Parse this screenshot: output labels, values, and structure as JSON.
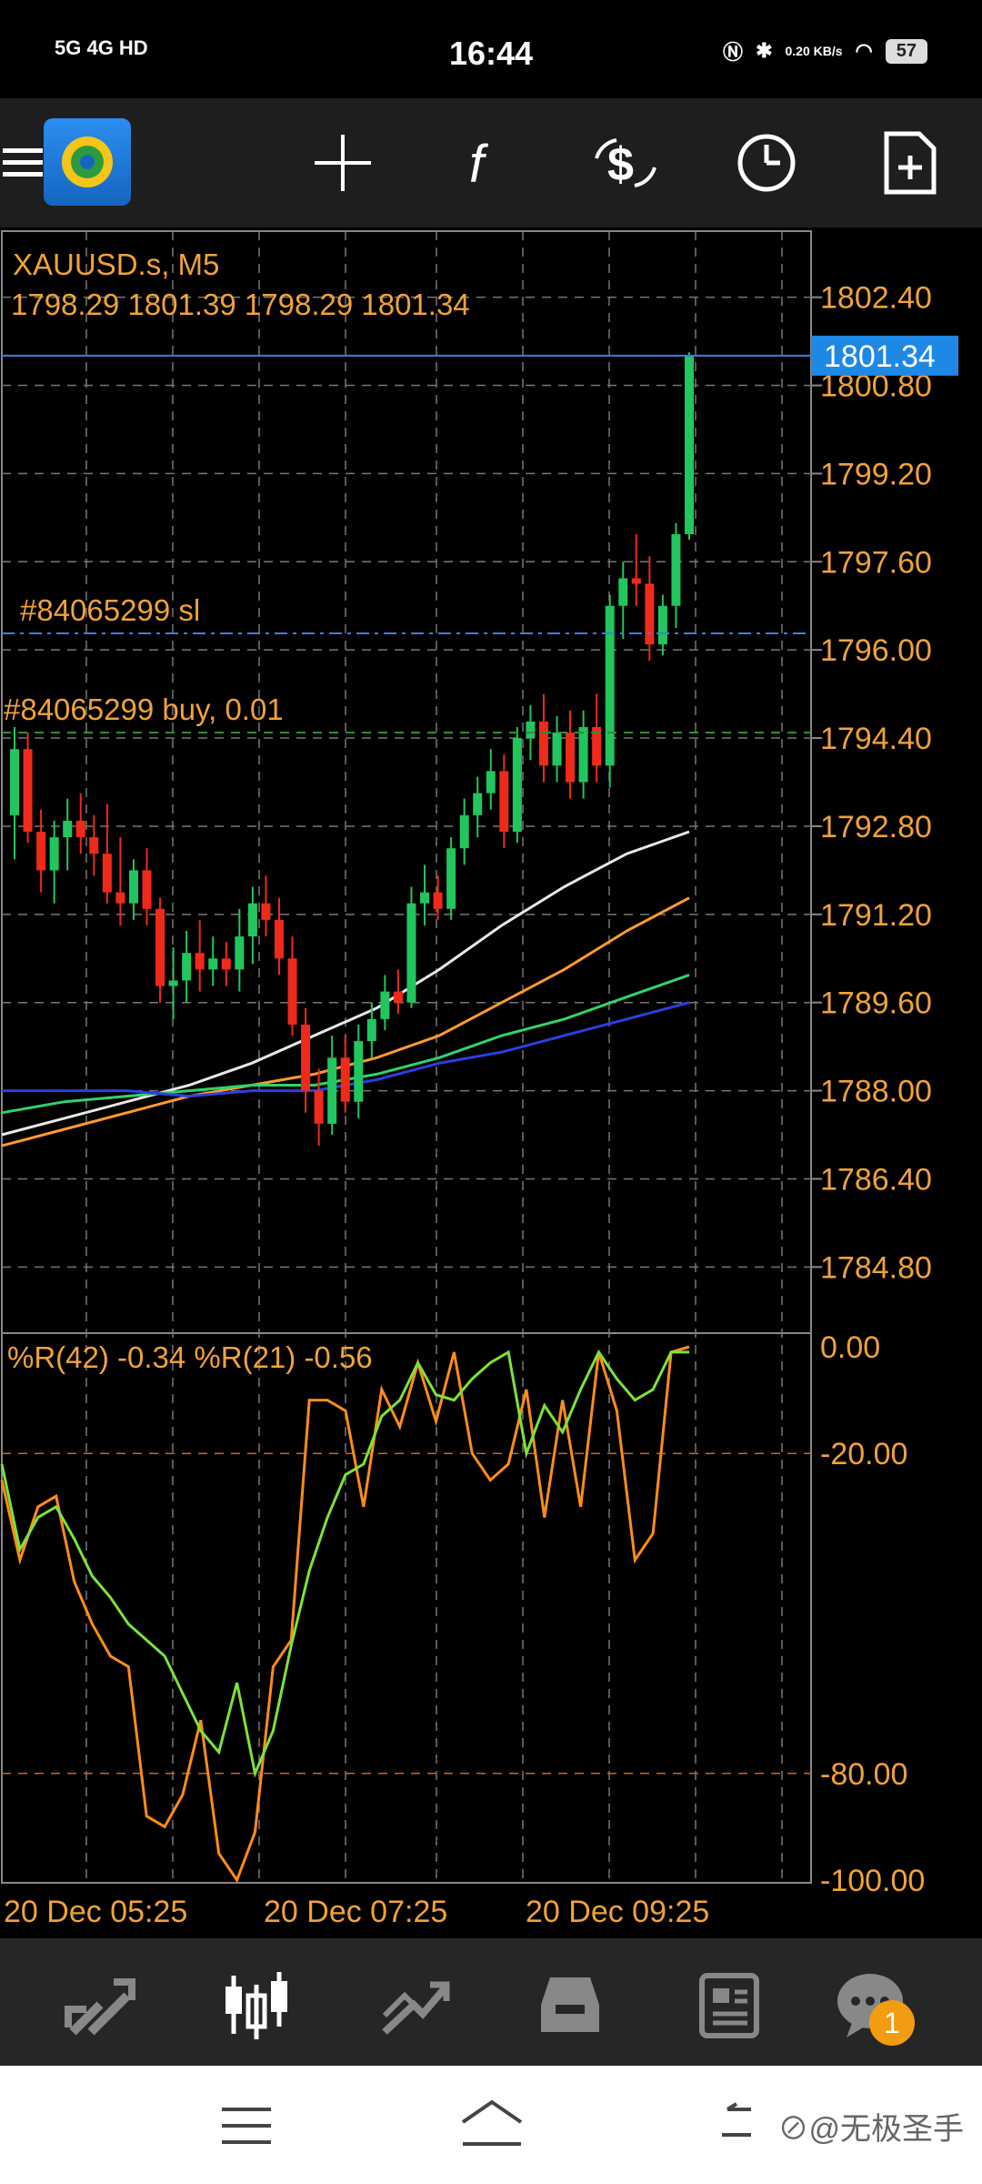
{
  "status_bar": {
    "left": "5G 4G HD",
    "time": "16:44",
    "speed": "0.20 KB/s",
    "battery": "57"
  },
  "toolbar": {
    "items": [
      "menu-icon",
      "app-logo",
      "crosshair-icon",
      "indicators-icon",
      "symbols-icon",
      "timeframe-icon",
      "new-order-icon"
    ]
  },
  "chart": {
    "symbol_label": "XAUUSD.s, M5",
    "ohlc_label": "1798.29 1801.39 1798.29 1801.34",
    "current_price": "1801.34",
    "sl_label": "#84065299 sl",
    "order_label": "#84065299 buy, 0.01",
    "price_ticks": [
      "1802.40",
      "1800.80",
      "1799.20",
      "1797.60",
      "1796.00",
      "1794.40",
      "1792.80",
      "1791.20",
      "1789.60",
      "1788.00",
      "1786.40",
      "1784.80"
    ],
    "time_ticks": [
      "20 Dec 05:25",
      "20 Dec 07:25",
      "20 Dec 09:25"
    ],
    "indicator_label": "%R(42) -0.34 %R(21) -0.56",
    "indicator_ticks": [
      "0.00",
      "-20.00",
      "-80.00",
      "-100.00"
    ],
    "colors": {
      "up": "#22c55e",
      "down": "#ef2a1a",
      "text": "#f0a23a",
      "grid": "#888888",
      "price_tag": "#1e88e5"
    }
  },
  "chart_data": {
    "type": "candlestick",
    "title": "XAUUSD.s, M5",
    "ylim": [
      1783.6,
      1803.6
    ],
    "sl_price": 1796.3,
    "order_price": 1794.5,
    "candles": [
      {
        "o": 1793.0,
        "h": 1794.6,
        "l": 1792.2,
        "c": 1794.2
      },
      {
        "o": 1794.2,
        "h": 1794.5,
        "l": 1792.5,
        "c": 1792.7
      },
      {
        "o": 1792.7,
        "h": 1793.1,
        "l": 1791.6,
        "c": 1792.0
      },
      {
        "o": 1792.0,
        "h": 1792.9,
        "l": 1791.4,
        "c": 1792.6
      },
      {
        "o": 1792.6,
        "h": 1793.3,
        "l": 1792.0,
        "c": 1792.9
      },
      {
        "o": 1792.9,
        "h": 1793.4,
        "l": 1792.3,
        "c": 1792.6
      },
      {
        "o": 1792.6,
        "h": 1793.0,
        "l": 1791.9,
        "c": 1792.3
      },
      {
        "o": 1792.3,
        "h": 1793.2,
        "l": 1791.4,
        "c": 1791.6
      },
      {
        "o": 1791.6,
        "h": 1792.6,
        "l": 1791.0,
        "c": 1791.4
      },
      {
        "o": 1791.4,
        "h": 1792.2,
        "l": 1791.1,
        "c": 1792.0
      },
      {
        "o": 1792.0,
        "h": 1792.4,
        "l": 1791.0,
        "c": 1791.3
      },
      {
        "o": 1791.3,
        "h": 1791.5,
        "l": 1789.6,
        "c": 1789.9
      },
      {
        "o": 1789.9,
        "h": 1790.6,
        "l": 1789.3,
        "c": 1790.0
      },
      {
        "o": 1790.0,
        "h": 1790.9,
        "l": 1789.6,
        "c": 1790.5
      },
      {
        "o": 1790.5,
        "h": 1791.1,
        "l": 1789.8,
        "c": 1790.2
      },
      {
        "o": 1790.2,
        "h": 1790.8,
        "l": 1789.9,
        "c": 1790.4
      },
      {
        "o": 1790.4,
        "h": 1790.7,
        "l": 1789.9,
        "c": 1790.2
      },
      {
        "o": 1790.2,
        "h": 1791.3,
        "l": 1789.8,
        "c": 1790.8
      },
      {
        "o": 1790.8,
        "h": 1791.7,
        "l": 1790.3,
        "c": 1791.4
      },
      {
        "o": 1791.4,
        "h": 1791.9,
        "l": 1790.8,
        "c": 1791.1
      },
      {
        "o": 1791.1,
        "h": 1791.5,
        "l": 1790.1,
        "c": 1790.4
      },
      {
        "o": 1790.4,
        "h": 1790.8,
        "l": 1789.0,
        "c": 1789.2
      },
      {
        "o": 1789.2,
        "h": 1789.5,
        "l": 1787.6,
        "c": 1788.0
      },
      {
        "o": 1788.0,
        "h": 1788.4,
        "l": 1787.0,
        "c": 1787.4
      },
      {
        "o": 1787.4,
        "h": 1789.0,
        "l": 1787.2,
        "c": 1788.6
      },
      {
        "o": 1788.6,
        "h": 1789.0,
        "l": 1787.6,
        "c": 1787.8
      },
      {
        "o": 1787.8,
        "h": 1789.2,
        "l": 1787.5,
        "c": 1788.9
      },
      {
        "o": 1788.9,
        "h": 1789.6,
        "l": 1788.6,
        "c": 1789.3
      },
      {
        "o": 1789.3,
        "h": 1790.1,
        "l": 1789.1,
        "c": 1789.8
      },
      {
        "o": 1789.8,
        "h": 1790.2,
        "l": 1789.4,
        "c": 1789.6
      },
      {
        "o": 1789.6,
        "h": 1791.7,
        "l": 1789.5,
        "c": 1791.4
      },
      {
        "o": 1791.4,
        "h": 1792.1,
        "l": 1791.0,
        "c": 1791.6
      },
      {
        "o": 1791.6,
        "h": 1791.9,
        "l": 1791.1,
        "c": 1791.3
      },
      {
        "o": 1791.3,
        "h": 1792.6,
        "l": 1791.1,
        "c": 1792.4
      },
      {
        "o": 1792.4,
        "h": 1793.3,
        "l": 1792.1,
        "c": 1793.0
      },
      {
        "o": 1793.0,
        "h": 1793.7,
        "l": 1792.6,
        "c": 1793.4
      },
      {
        "o": 1793.4,
        "h": 1794.2,
        "l": 1793.1,
        "c": 1793.8
      },
      {
        "o": 1793.8,
        "h": 1794.1,
        "l": 1792.4,
        "c": 1792.7
      },
      {
        "o": 1792.7,
        "h": 1794.6,
        "l": 1792.5,
        "c": 1794.4
      },
      {
        "o": 1794.4,
        "h": 1795.0,
        "l": 1794.0,
        "c": 1794.7
      },
      {
        "o": 1794.7,
        "h": 1795.2,
        "l": 1793.6,
        "c": 1793.9
      },
      {
        "o": 1793.9,
        "h": 1794.8,
        "l": 1793.6,
        "c": 1794.5
      },
      {
        "o": 1794.5,
        "h": 1794.9,
        "l": 1793.3,
        "c": 1793.6
      },
      {
        "o": 1793.6,
        "h": 1794.9,
        "l": 1793.3,
        "c": 1794.6
      },
      {
        "o": 1794.6,
        "h": 1795.2,
        "l": 1793.6,
        "c": 1793.9
      },
      {
        "o": 1793.9,
        "h": 1797.0,
        "l": 1793.5,
        "c": 1796.8
      },
      {
        "o": 1796.8,
        "h": 1797.6,
        "l": 1796.2,
        "c": 1797.3
      },
      {
        "o": 1797.3,
        "h": 1798.1,
        "l": 1796.8,
        "c": 1797.2
      },
      {
        "o": 1797.2,
        "h": 1797.7,
        "l": 1795.8,
        "c": 1796.1
      },
      {
        "o": 1796.1,
        "h": 1797.0,
        "l": 1795.9,
        "c": 1796.8
      },
      {
        "o": 1796.8,
        "h": 1798.3,
        "l": 1796.4,
        "c": 1798.1
      },
      {
        "o": 1798.1,
        "h": 1801.4,
        "l": 1798.0,
        "c": 1801.34
      }
    ],
    "moving_averages": [
      {
        "color": "#e8e8e8",
        "values": [
          1787.2,
          1787.5,
          1787.8,
          1788.1,
          1788.5,
          1789.0,
          1789.5,
          1790.2,
          1791.0,
          1791.7,
          1792.3,
          1792.7
        ]
      },
      {
        "color": "#ff9a2e",
        "values": [
          1787.0,
          1787.3,
          1787.6,
          1787.9,
          1788.1,
          1788.3,
          1788.6,
          1789.0,
          1789.6,
          1790.2,
          1790.9,
          1791.5
        ]
      },
      {
        "color": "#2fd36b",
        "values": [
          1787.6,
          1787.8,
          1787.9,
          1788.0,
          1788.1,
          1788.1,
          1788.3,
          1788.6,
          1789.0,
          1789.3,
          1789.7,
          1790.1
        ]
      },
      {
        "color": "#2b3fe0",
        "values": [
          1788.0,
          1788.0,
          1788.0,
          1787.9,
          1788.0,
          1788.0,
          1788.2,
          1788.5,
          1788.7,
          1789.0,
          1789.3,
          1789.6
        ]
      }
    ],
    "williams_r": [
      {
        "name": "%R(42)",
        "color": "#7be33a",
        "values": [
          -22,
          -38,
          -32,
          -30,
          -36,
          -43,
          -47,
          -52,
          -55,
          -58,
          -65,
          -72,
          -76,
          -63,
          -80,
          -72,
          -56,
          -42,
          -32,
          -24,
          -22,
          -13,
          -10,
          -3,
          -9,
          -10,
          -6,
          -3,
          -1,
          -20,
          -11,
          -16,
          -8,
          -1,
          -6,
          -10,
          -8,
          -1,
          -1
        ]
      },
      {
        "name": "%R(21)",
        "color": "#ff8c1a",
        "values": [
          -25,
          -40,
          -30,
          -28,
          -44,
          -52,
          -58,
          -60,
          -88,
          -90,
          -84,
          -70,
          -95,
          -100,
          -91,
          -60,
          -55,
          -10,
          -10,
          -12,
          -30,
          -8,
          -15,
          -3,
          -14,
          -1,
          -20,
          -25,
          -22,
          -8,
          -32,
          -10,
          -30,
          -1,
          -12,
          -40,
          -35,
          -1,
          0
        ]
      }
    ]
  },
  "bottom_nav": {
    "badge": "1"
  },
  "system_nav": {
    "watermark": "⊘@无极圣手"
  }
}
